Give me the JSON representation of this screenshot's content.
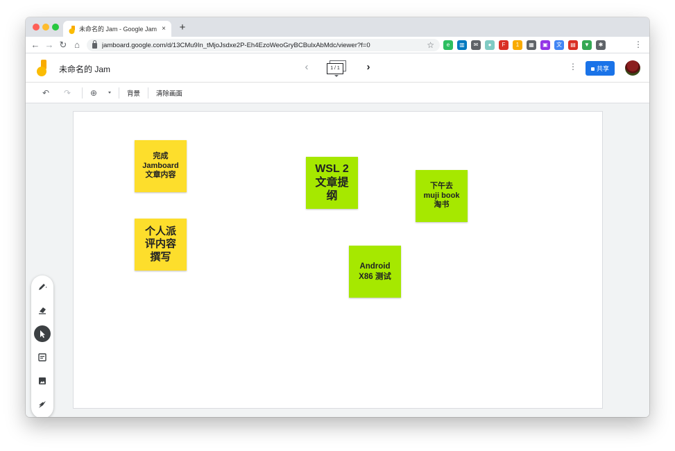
{
  "browser": {
    "tab_title": "未命名的 Jam - Google Jamboard",
    "tab_close": "×",
    "new_tab": "+",
    "url": "jamboard.google.com/d/13CMu9In_tMjoJsdxe2P-Eh4EzoWeoGryBCBulxAbMdc/viewer?f=0",
    "nav": {
      "back": "←",
      "forward": "→",
      "reload": "↻",
      "home": "⌂"
    },
    "star": "☆",
    "menu": "⋮",
    "extensions": [
      {
        "name": "evernote-icon",
        "color": "#2dbe60",
        "glyph": "e"
      },
      {
        "name": "trello-icon",
        "color": "#0079bf",
        "glyph": "▥"
      },
      {
        "name": "mail-icon",
        "color": "#5f6368",
        "glyph": "✉"
      },
      {
        "name": "circle-ext-icon",
        "color": "#80cbc4",
        "glyph": "●"
      },
      {
        "name": "flash-ext-icon",
        "color": "#d93025",
        "glyph": "F"
      },
      {
        "name": "badge-ext-icon",
        "color": "#f9ab00",
        "glyph": "1"
      },
      {
        "name": "qr-ext-icon",
        "color": "#5f6368",
        "glyph": "▦"
      },
      {
        "name": "purple-ext-icon",
        "color": "#9334e6",
        "glyph": "▣"
      },
      {
        "name": "translate-ext-icon",
        "color": "#4285f4",
        "glyph": "文"
      },
      {
        "name": "screenshot-ext-icon",
        "color": "#d93025",
        "glyph": "▤"
      },
      {
        "name": "shield-ext-icon",
        "color": "#34a853",
        "glyph": "▼"
      },
      {
        "name": "puzzle-ext-icon",
        "color": "#5f6368",
        "glyph": "✱"
      }
    ]
  },
  "app": {
    "title": "未命名的 Jam",
    "frame_indicator": "1 / 1",
    "prev": "‹",
    "next": "›",
    "more": "⋮",
    "share_label": "共享"
  },
  "toolbar": {
    "undo": "↶",
    "redo": "↷",
    "zoom": "⊕",
    "background_label": "背景",
    "clear_label": "清除画面"
  },
  "notes": [
    {
      "id": "note-1",
      "text": "完成\nJamboard\n文章内容",
      "color": "yellow",
      "size": "11px"
    },
    {
      "id": "note-2",
      "text": "个人派\n评内容\n撰写",
      "color": "yellow",
      "size": "15px"
    },
    {
      "id": "note-3",
      "text": "WSL 2\n文章提\n纲",
      "color": "green",
      "size": "16px"
    },
    {
      "id": "note-4",
      "text": "下午去\nmuji book\n淘书",
      "color": "green",
      "size": "11px"
    },
    {
      "id": "note-5",
      "text": "Android\nX86 测试",
      "color": "green",
      "size": "11.5px"
    }
  ],
  "tools": [
    {
      "name": "pen-tool-icon",
      "active": false
    },
    {
      "name": "eraser-tool-icon",
      "active": false
    },
    {
      "name": "select-tool-icon",
      "active": true
    },
    {
      "name": "sticky-note-tool-icon",
      "active": false
    },
    {
      "name": "image-tool-icon",
      "active": false
    },
    {
      "name": "laser-tool-icon",
      "active": false
    }
  ]
}
